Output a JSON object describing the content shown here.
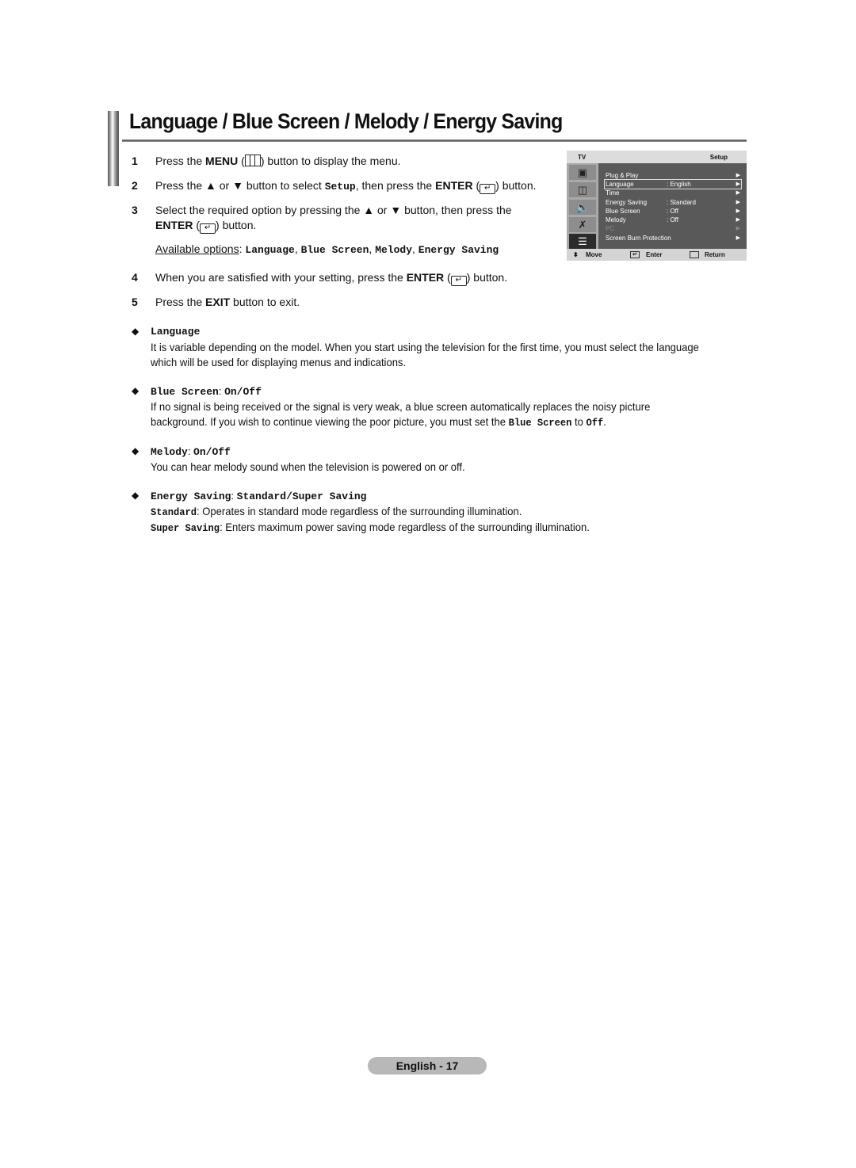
{
  "title": "Language / Blue Screen / Melody / Energy Saving",
  "steps": [
    {
      "num": "1",
      "pre": "Press the ",
      "bold": "MENU",
      "post": " button to display the menu.",
      "icon": "menu-icon"
    },
    {
      "num": "2",
      "pre": "Press the ▲ or ▼ button to select ",
      "code": "Setup",
      "mid": ", then press the ",
      "bold": "ENTER",
      "post": " button.",
      "icon": "enter-icon"
    },
    {
      "num": "3",
      "line1": "Select the required option by pressing the ▲ or ▼ button, then press the",
      "bold": "ENTER",
      "post": " button.",
      "icon": "enter-icon"
    },
    {
      "num": "4",
      "pre": "When you are satisfied with your setting, press the ",
      "bold": "ENTER",
      "post": " button.",
      "icon": "enter-icon"
    },
    {
      "num": "5",
      "pre": "Press the ",
      "bold": "EXIT",
      "post": " button to exit."
    }
  ],
  "available": {
    "label": "Available options",
    "options": [
      "Language",
      "Blue Screen",
      "Melody",
      "Energy Saving"
    ]
  },
  "osd": {
    "header_left": "TV",
    "header_right": "Setup",
    "side_icons": [
      "picture-icon",
      "channel-icon",
      "sound-icon",
      "antenna-icon",
      "setup-icon"
    ],
    "rows": [
      {
        "label": "Plug & Play",
        "value": "",
        "state": "normal"
      },
      {
        "label": "Language",
        "value": ": English",
        "state": "selected"
      },
      {
        "label": "Time",
        "value": "",
        "state": "normal"
      },
      {
        "label": "Energy Saving",
        "value": ": Standard",
        "state": "normal"
      },
      {
        "label": "Blue Screen",
        "value": ": Off",
        "state": "normal"
      },
      {
        "label": "Melody",
        "value": ": Off",
        "state": "normal"
      },
      {
        "label": "PC",
        "value": "",
        "state": "disabled"
      },
      {
        "label": "Screen Burn Protection",
        "value": "",
        "state": "normal"
      }
    ],
    "footer": {
      "move": "Move",
      "enter": "Enter",
      "return": "Return"
    }
  },
  "sections": [
    {
      "name": "Language",
      "options": "",
      "lines": [
        "It is variable depending on the model. When you start using the television for the first time, you must select the language",
        "which will be used for displaying menus and indications."
      ]
    },
    {
      "name": "Blue Screen",
      "options": "On/Off",
      "lines": [
        "If no signal is being received or the signal is very weak, a blue screen automatically replaces the noisy picture",
        "background. If you wish to continue viewing the poor picture, you must set the "
      ],
      "tail_code1": "Blue Screen",
      "tail_mid": " to ",
      "tail_code2": "Off",
      "tail_end": "."
    },
    {
      "name": "Melody",
      "options": "On/Off",
      "lines": [
        "You can hear melody sound when the television is powered on or off."
      ]
    },
    {
      "name": "Energy Saving",
      "options": "Standard/Super Saving",
      "items": [
        {
          "term": "Standard",
          "desc": ": Operates in standard mode regardless of the surrounding illumination."
        },
        {
          "term": "Super Saving",
          "desc": ": Enters maximum power saving mode regardless of the surrounding illumination."
        }
      ]
    }
  ],
  "footer": {
    "page_label": "English - 17"
  }
}
